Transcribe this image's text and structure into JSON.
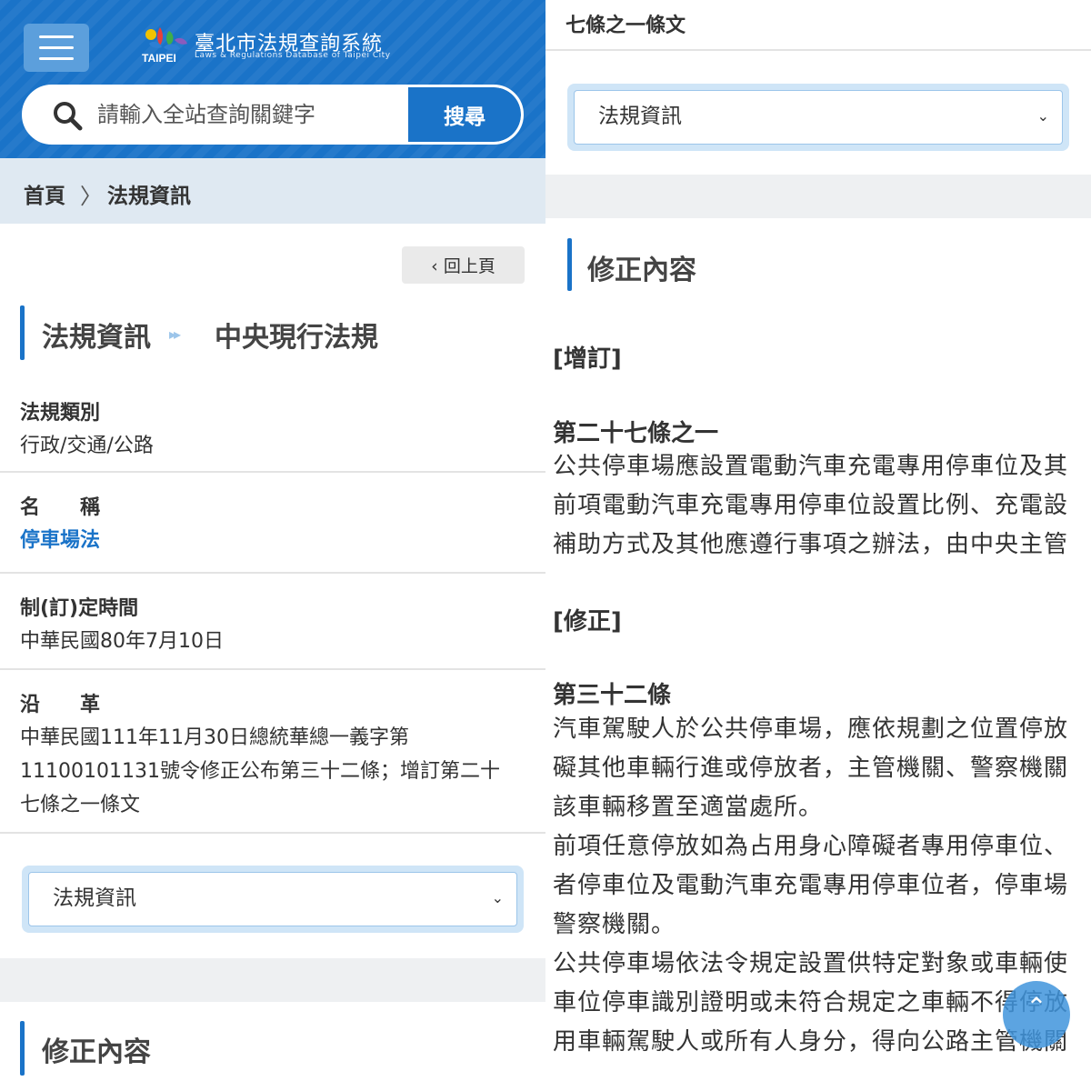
{
  "header": {
    "site_title": "臺北市法規查詢系統",
    "site_subtitle": "Laws & Regulations Database of Taipei City",
    "logo_text": "TAIPEI",
    "menu_icon": "hamburger-icon"
  },
  "search": {
    "placeholder": "請輸入全站查詢關鍵字",
    "button_label": "搜尋",
    "icon": "search-icon"
  },
  "breadcrumb": {
    "items": [
      "首頁",
      "法規資訊"
    ],
    "separator": "〉"
  },
  "back_button": {
    "label": "回上頁",
    "icon": "chevron-left-icon"
  },
  "page_heading": {
    "part1": "法規資訊",
    "part2": "中央現行法規",
    "arrows": "▸▸"
  },
  "fields": {
    "category": {
      "label": "法規類別",
      "value": "行政/交通/公路"
    },
    "name": {
      "label": "名　　稱",
      "value": "停車場法"
    },
    "enacted": {
      "label": "制(訂)定時間",
      "value": "中華民國80年7月10日"
    },
    "history": {
      "label": "沿　　革",
      "lines": [
        "中華民國111年11月30日總統華總一義字第",
        "11100101131號令修正公布第三十二條；增訂第二十",
        "七條之一條文"
      ]
    }
  },
  "select": {
    "value": "法規資訊",
    "icon": "chevron-down-icon"
  },
  "amend_heading": "修正內容",
  "right": {
    "top_line": "七條之一條文",
    "select_value": "法規資訊",
    "amend_heading": "修正內容",
    "tag_add": "[增訂]",
    "article1_title": "第二十七條之一",
    "article1_lines": [
      "公共停車場應設置電動汽車充電專用停車位及其",
      "前項電動汽車充電專用停車位設置比例、充電設",
      "補助方式及其他應遵行事項之辦法，由中央主管"
    ],
    "tag_amend": "[修正]",
    "article2_title": "第三十二條",
    "article2_lines": [
      "汽車駕駛人於公共停車場，應依規劃之位置停放",
      "礙其他車輛行進或停放者，主管機關、警察機關",
      "該車輛移置至適當處所。",
      "前項任意停放如為占用身心障礙者專用停車位、",
      "者停車位及電動汽車充電專用停車位者，停車場",
      "警察機關。",
      "公共停車場依法令規定設置供特定對象或車輛使",
      "車位停車識別證明或未符合規定之車輛不得停放",
      "用車輛駕駛人或所有人身分，得向公路主管機關"
    ],
    "fab_icon": "chevron-up-icon"
  }
}
